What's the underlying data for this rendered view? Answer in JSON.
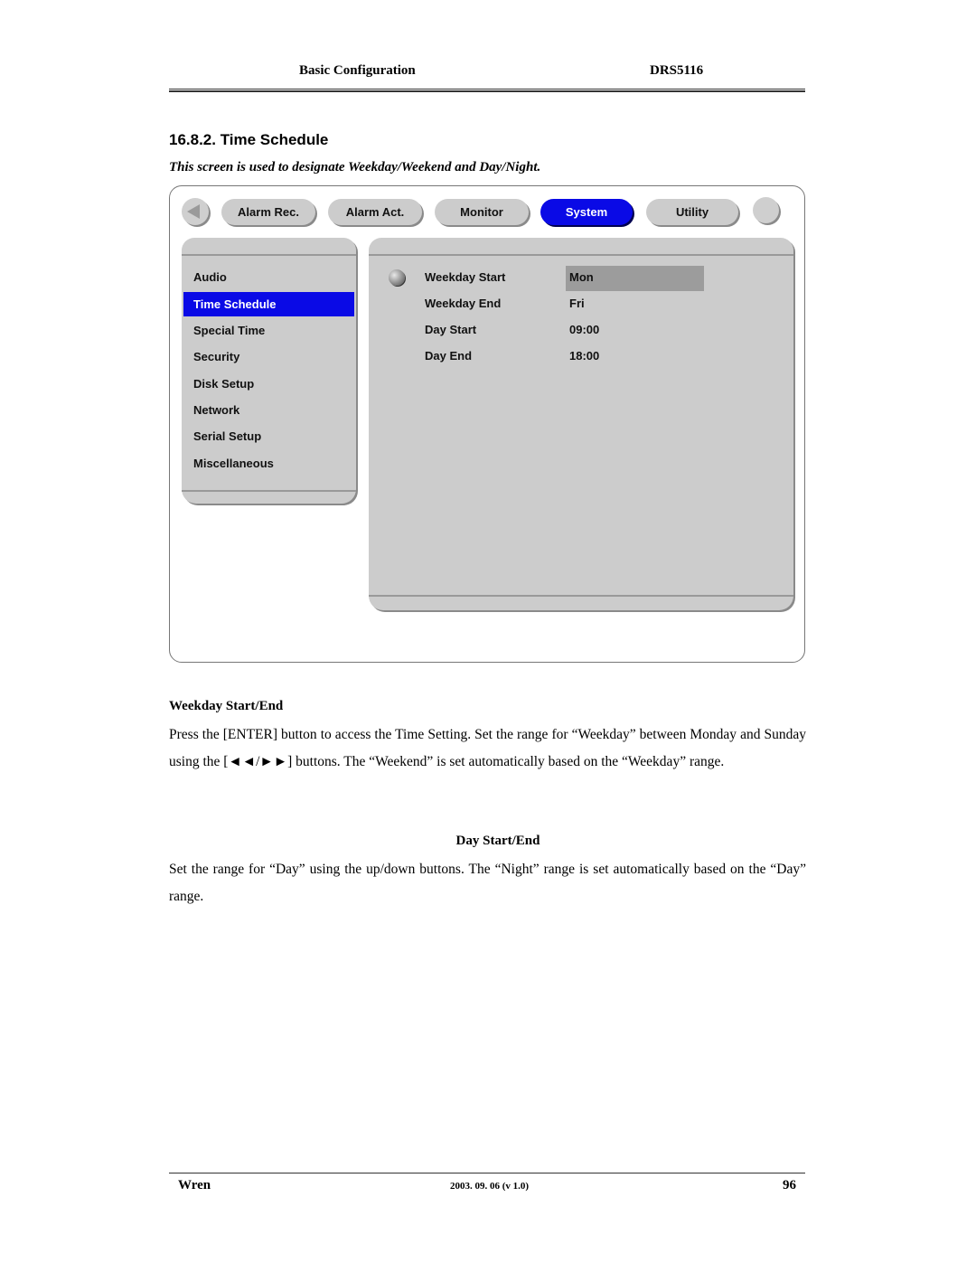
{
  "header": {
    "title": "Basic Configuration",
    "model": "DRS5116"
  },
  "section": {
    "title": "16.8.2. Time Schedule",
    "subtitle": "This screen is used to designate Weekday/Weekend and Day/Night."
  },
  "screen": {
    "nav_back_icon": "left-triangle-icon",
    "tabs": [
      {
        "label": "Alarm Rec.",
        "active": false
      },
      {
        "label": "Alarm Act.",
        "active": false
      },
      {
        "label": "Monitor",
        "active": false
      },
      {
        "label": "System",
        "active": true
      },
      {
        "label": "Utility",
        "active": false
      }
    ],
    "menu": [
      {
        "label": "Audio",
        "active": false
      },
      {
        "label": "Time Schedule",
        "active": true
      },
      {
        "label": "Special Time",
        "active": false
      },
      {
        "label": "Security",
        "active": false
      },
      {
        "label": "Disk Setup",
        "active": false
      },
      {
        "label": "Network",
        "active": false
      },
      {
        "label": "Serial Setup",
        "active": false
      },
      {
        "label": "Miscellaneous",
        "active": false
      }
    ],
    "settings": [
      {
        "label": "Weekday Start",
        "value": "Mon",
        "selected": true
      },
      {
        "label": "Weekday End",
        "value": "Fri",
        "selected": false
      },
      {
        "label": "Day Start",
        "value": "09:00",
        "selected": false
      },
      {
        "label": "Day End",
        "value": "18:00",
        "selected": false
      }
    ],
    "colors": {
      "active": "#0a0ae6",
      "panel": "#cccccc",
      "highlight": "#9c9c9c"
    }
  },
  "body": {
    "weekday_heading": "Weekday Start/End",
    "weekday_text": "Press the [ENTER] button to access the Time Setting.   Set the range for “Weekday” between Monday and Sunday using the [◄◄/►►] buttons.   The “Weekend” is set automatically based on the “Weekday” range.",
    "day_heading": "Day Start/End",
    "day_text": "Set the range for “Day” using the up/down buttons.   The “Night” range is set automatically based on the “Day” range."
  },
  "footer": {
    "company": "Wren",
    "version": "2003. 09. 06 (v 1.0)",
    "page": "96"
  }
}
